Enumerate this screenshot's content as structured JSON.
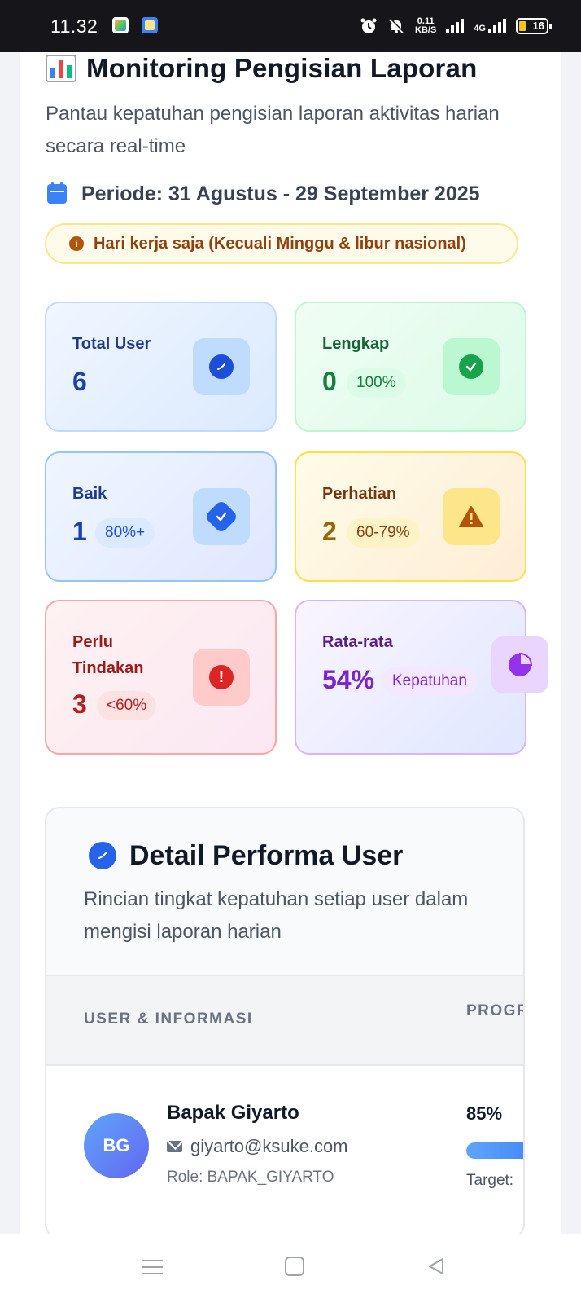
{
  "status_bar": {
    "time": "11.32",
    "speed_value": "0.11",
    "speed_unit": "KB/S",
    "network": "4G",
    "battery": "16"
  },
  "header": {
    "title": "Monitoring Pengisian Laporan",
    "subtitle": "Pantau kepatuhan pengisian laporan aktivitas harian secara real-time",
    "periode": "Periode: 31 Agustus - 29 September 2025",
    "notice": "Hari kerja saja (Kecuali Minggu & libur nasional)"
  },
  "stats": {
    "total_user": {
      "label": "Total User",
      "value": "6",
      "color": "#1e40af"
    },
    "lengkap": {
      "label": "Lengkap",
      "value": "0",
      "pill": "100%",
      "color": "#15803d"
    },
    "baik": {
      "label": "Baik",
      "value": "1",
      "pill": "80%+",
      "color": "#1e40af"
    },
    "perhatian": {
      "label": "Perhatian",
      "value": "2",
      "pill": "60-79%",
      "color": "#a16207"
    },
    "perlu_tindakan": {
      "label": "Perlu Tindakan",
      "value": "3",
      "pill": "<60%",
      "color": "#b91c1c"
    },
    "rata_rata": {
      "label": "Rata-rata",
      "value": "54%",
      "pill": "Kepatuhan",
      "color": "#7e22ce"
    }
  },
  "detail": {
    "title": "Detail Performa User",
    "subtitle": "Rincian tingkat kepatuhan setiap user dalam mengisi laporan harian",
    "columns": [
      "USER & INFORMASI",
      "PROGRESS PRESENSI"
    ],
    "rows": [
      {
        "initials": "BG",
        "name": "Bapak Giyarto",
        "email": "giyarto@ksuke.com",
        "role": "Role: BAPAK_GIYARTO",
        "percent": "85%",
        "progress": 0.85,
        "target_label": "Target:"
      }
    ]
  }
}
